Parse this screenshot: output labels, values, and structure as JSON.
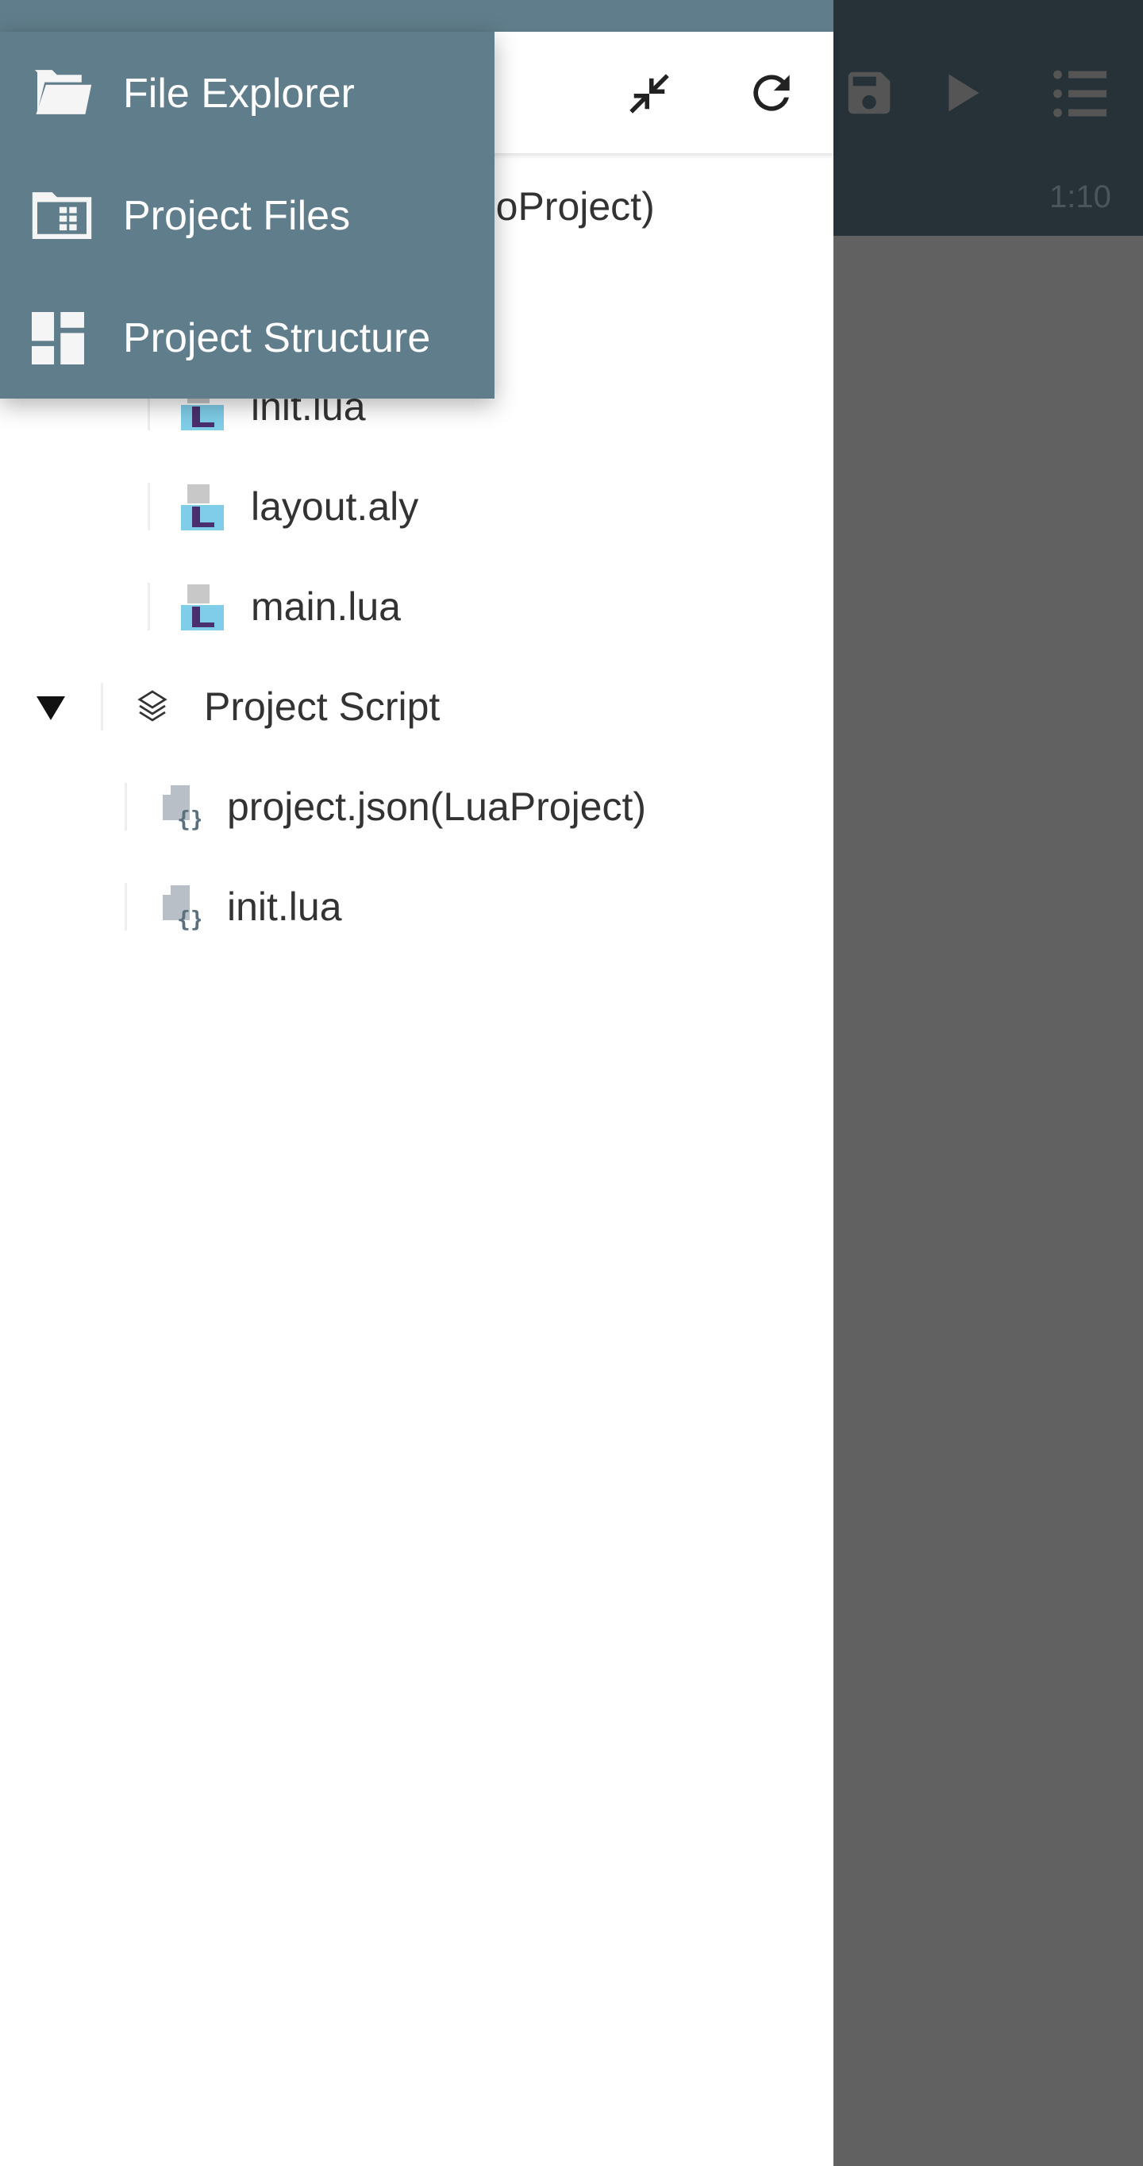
{
  "editor": {
    "cursor_position": "1:10",
    "toolbar": [
      "save-icon",
      "play-icon",
      "list-icon"
    ]
  },
  "drawer": {
    "toolbar": {
      "icons": [
        "collapse-icon",
        "refresh-icon"
      ]
    },
    "tree": {
      "root_partial": "moProject)",
      "items": [
        {
          "label": "init.lua",
          "icon": "lua-file-icon"
        },
        {
          "label": "layout.aly",
          "icon": "lua-file-icon"
        },
        {
          "label": "main.lua",
          "icon": "lua-file-icon"
        }
      ],
      "group": {
        "label": "Project Script",
        "expanded": true,
        "icon": "layers-icon",
        "items": [
          {
            "label": "project.json(LuaProject)",
            "icon": "json-file-icon"
          },
          {
            "label": "init.lua",
            "icon": "json-file-icon"
          }
        ]
      }
    }
  },
  "menu": {
    "items": [
      {
        "label": "File Explorer",
        "icon": "folder-open-icon"
      },
      {
        "label": "Project Files",
        "icon": "project-files-icon"
      },
      {
        "label": "Project Structure",
        "icon": "dashboard-icon"
      }
    ]
  },
  "colors": {
    "primary": "#607d8b",
    "dark": "#263238",
    "overlay": "#616161"
  }
}
